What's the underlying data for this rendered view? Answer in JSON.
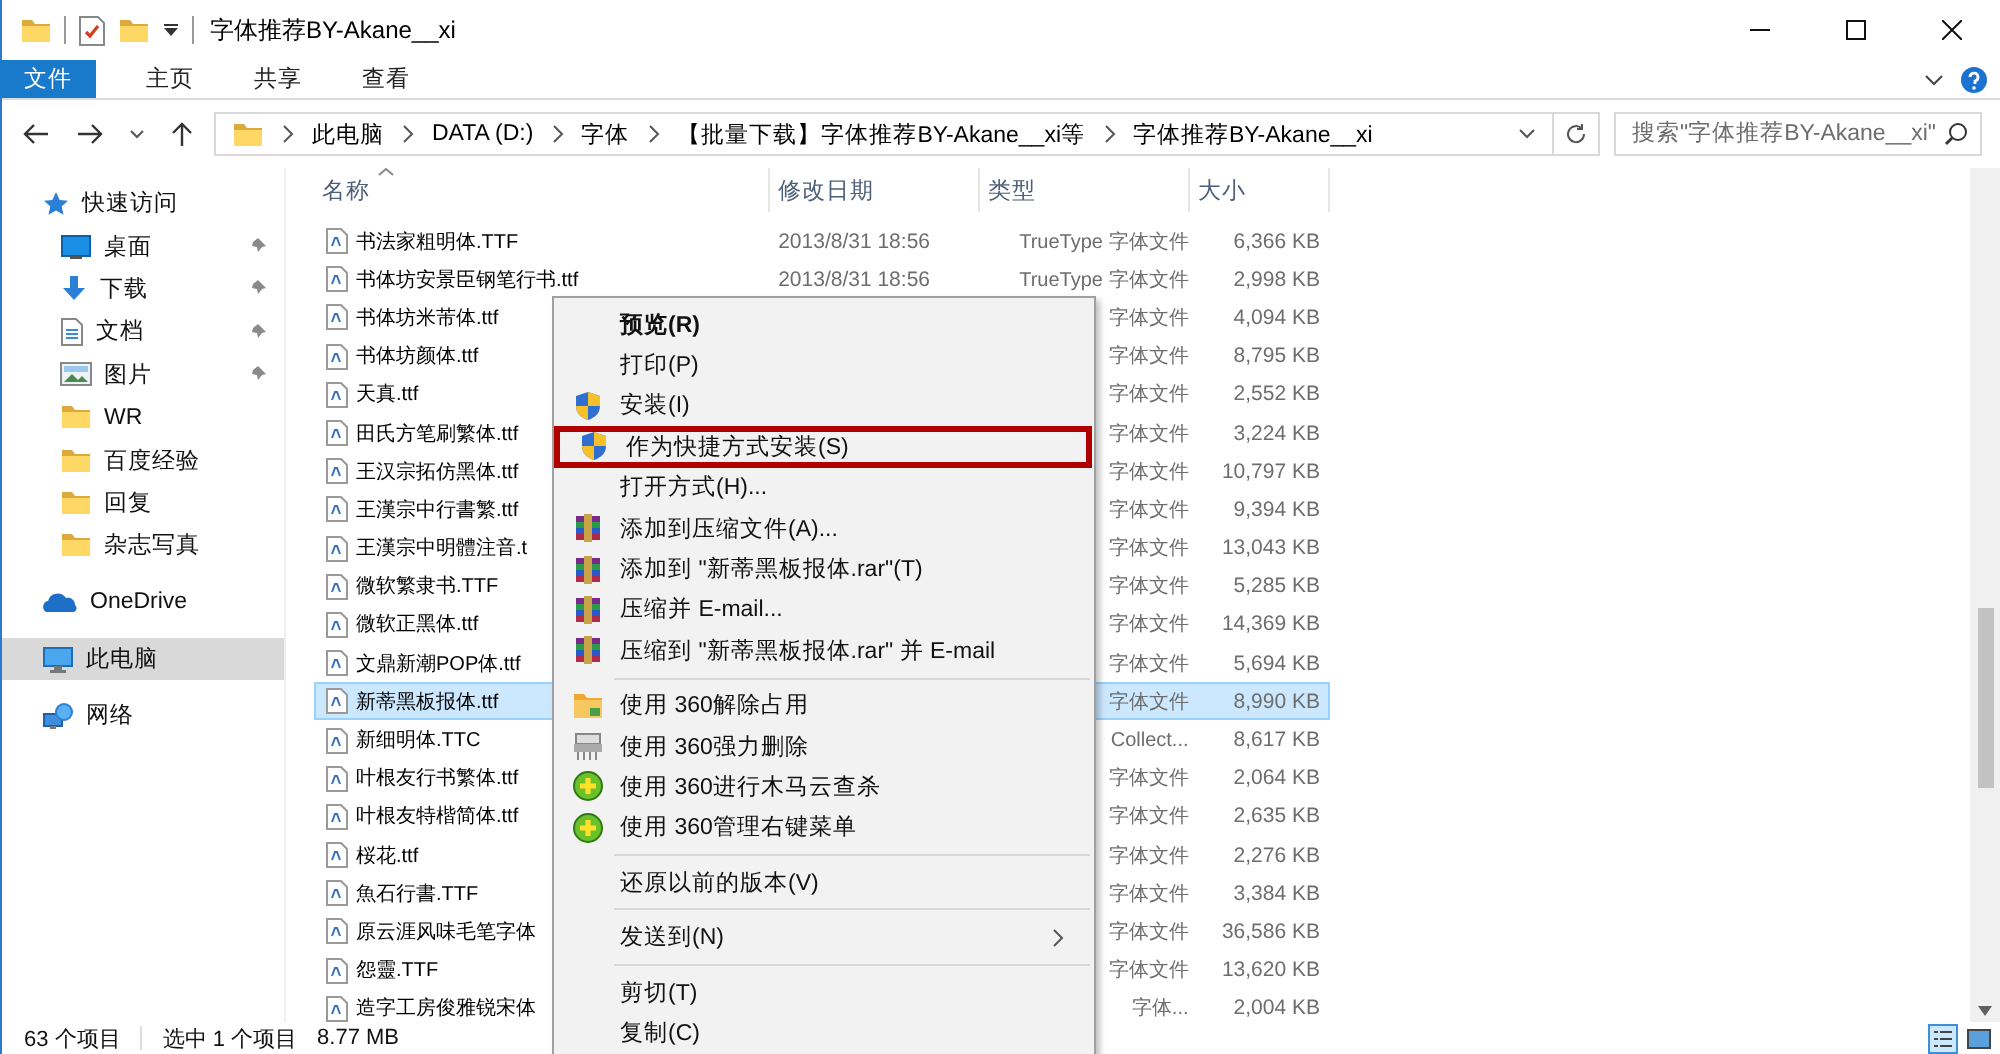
{
  "window": {
    "title": "字体推荐BY-Akane__xi"
  },
  "ribbon": {
    "tabs": [
      {
        "label": "文件",
        "kind": "file"
      },
      {
        "label": "主页",
        "kind": "tab"
      },
      {
        "label": "共享",
        "kind": "tab"
      },
      {
        "label": "查看",
        "kind": "tab"
      }
    ]
  },
  "address": {
    "breadcrumbs": [
      "此电脑",
      "DATA (D:)",
      "字体",
      "【批量下载】字体推荐BY-Akane__xi等",
      "字体推荐BY-Akane__xi"
    ]
  },
  "search": {
    "placeholder": "搜索\"字体推荐BY-Akane__xi\""
  },
  "sidebar": {
    "items": [
      {
        "label": "快速访问",
        "kind": "star",
        "selected": false,
        "children": [
          {
            "label": "桌面",
            "kind": "desktop",
            "pinned": true,
            "selected": false
          },
          {
            "label": "下载",
            "kind": "download",
            "pinned": true,
            "selected": false
          },
          {
            "label": "文档",
            "kind": "document",
            "pinned": true,
            "selected": false
          },
          {
            "label": "图片",
            "kind": "pictures",
            "pinned": true,
            "selected": false
          },
          {
            "label": "WR",
            "kind": "folder",
            "pinned": false,
            "selected": false
          },
          {
            "label": "百度经验",
            "kind": "folder",
            "pinned": false,
            "selected": false
          },
          {
            "label": "回复",
            "kind": "folder",
            "pinned": false,
            "selected": false
          },
          {
            "label": "杂志写真",
            "kind": "folder",
            "pinned": false,
            "selected": false
          }
        ]
      },
      {
        "label": "OneDrive",
        "kind": "cloud",
        "selected": false
      },
      {
        "label": "此电脑",
        "kind": "computer",
        "selected": true
      },
      {
        "label": "网络",
        "kind": "network",
        "selected": false
      }
    ]
  },
  "file_list": {
    "columns": [
      "名称",
      "修改日期",
      "类型",
      "大小"
    ],
    "rows": [
      {
        "name": "书法家粗明体.TTF",
        "date": "2013/8/31 18:56",
        "type": "TrueType 字体文件",
        "size": "6,366 KB",
        "selected": false
      },
      {
        "name": "书体坊安景臣钢笔行书.ttf",
        "date": "2013/8/31 18:56",
        "type": "TrueType 字体文件",
        "size": "2,998 KB",
        "selected": false
      },
      {
        "name": "书体坊米芾体.ttf",
        "type": "字体文件",
        "size": "4,094 KB",
        "selected": false
      },
      {
        "name": "书体坊颜体.ttf",
        "type": "字体文件",
        "size": "8,795 KB",
        "selected": false
      },
      {
        "name": "天真.ttf",
        "type": "字体文件",
        "size": "2,552 KB",
        "selected": false
      },
      {
        "name": "田氏方笔刷繁体.ttf",
        "type": "字体文件",
        "size": "3,224 KB",
        "selected": false
      },
      {
        "name": "王汉宗拓仿黑体.ttf",
        "type": "字体文件",
        "size": "10,797 KB",
        "selected": false
      },
      {
        "name": "王漢宗中行書繁.ttf",
        "type": "字体文件",
        "size": "9,394 KB",
        "selected": false
      },
      {
        "name": "王漢宗中明體注音.t",
        "type": "字体文件",
        "size": "13,043 KB",
        "selected": false
      },
      {
        "name": "微软繁隶书.TTF",
        "type": "字体文件",
        "size": "5,285 KB",
        "selected": false
      },
      {
        "name": "微软正黑体.ttf",
        "type": "字体文件",
        "size": "14,369 KB",
        "selected": false
      },
      {
        "name": "文鼎新潮POP体.ttf",
        "type": "字体文件",
        "size": "5,694 KB",
        "selected": false
      },
      {
        "name": "新蒂黑板报体.ttf",
        "type": "字体文件",
        "size": "8,990 KB",
        "selected": true
      },
      {
        "name": "新细明体.TTC",
        "type": "Collect...",
        "size": "8,617 KB",
        "selected": false
      },
      {
        "name": "叶根友行书繁体.ttf",
        "type": "字体文件",
        "size": "2,064 KB",
        "selected": false
      },
      {
        "name": "叶根友特楷简体.ttf",
        "type": "字体文件",
        "size": "2,635 KB",
        "selected": false
      },
      {
        "name": "桜花.ttf",
        "type": "字体文件",
        "size": "2,276 KB",
        "selected": false
      },
      {
        "name": "魚石行書.TTF",
        "type": "字体文件",
        "size": "3,384 KB",
        "selected": false
      },
      {
        "name": "原云涯风味毛笔字体",
        "type": "字体文件",
        "size": "36,586 KB",
        "selected": false
      },
      {
        "name": "怨靈.TTF",
        "type": "字体文件",
        "size": "13,620 KB",
        "selected": false
      },
      {
        "name": "造字工房俊雅锐宋体",
        "type": "字体...",
        "size": "2,004 KB",
        "selected": false
      }
    ]
  },
  "context_menu": {
    "items": [
      {
        "kind": "plain",
        "label": "预览(R)",
        "default": true,
        "highlighted": false
      },
      {
        "kind": "plain",
        "label": "打印(P)",
        "default": false,
        "highlighted": false
      },
      {
        "kind": "shield",
        "label": "安装(I)",
        "default": false,
        "highlighted": false
      },
      {
        "kind": "shield",
        "label": "作为快捷方式安装(S)",
        "default": false,
        "highlighted": true
      },
      {
        "kind": "plain",
        "label": "打开方式(H)...",
        "default": false,
        "highlighted": false
      },
      {
        "kind": "archive",
        "label": "添加到压缩文件(A)...",
        "default": false,
        "highlighted": false
      },
      {
        "kind": "archive",
        "label": "添加到 \"新蒂黑板报体.rar\"(T)",
        "default": false,
        "highlighted": false
      },
      {
        "kind": "archive",
        "label": "压缩并 E-mail...",
        "default": false,
        "highlighted": false
      },
      {
        "kind": "archive",
        "label": "压缩到 \"新蒂黑板报体.rar\" 并 E-mail",
        "default": false,
        "highlighted": false
      },
      {
        "kind": "separator"
      },
      {
        "kind": "unlock",
        "label": "使用 360解除占用",
        "default": false,
        "highlighted": false
      },
      {
        "kind": "shredder",
        "label": "使用 360强力删除",
        "default": false,
        "highlighted": false
      },
      {
        "kind": "plus",
        "label": "使用 360进行木马云查杀",
        "default": false,
        "highlighted": false
      },
      {
        "kind": "plus",
        "label": "使用 360管理右键菜单",
        "default": false,
        "highlighted": false
      },
      {
        "kind": "separator"
      },
      {
        "kind": "plain",
        "label": "还原以前的版本(V)",
        "default": false,
        "highlighted": false
      },
      {
        "kind": "separator"
      },
      {
        "kind": "submenu",
        "label": "发送到(N)",
        "default": false,
        "highlighted": false
      },
      {
        "kind": "separator"
      },
      {
        "kind": "plain",
        "label": "剪切(T)",
        "default": false,
        "highlighted": false
      },
      {
        "kind": "plain",
        "label": "复制(C)",
        "default": false,
        "highlighted": false
      }
    ]
  },
  "status_bar": {
    "item_count": "63 个项目",
    "selection": "选中 1 个项目",
    "selection_size": "8.77 MB"
  }
}
